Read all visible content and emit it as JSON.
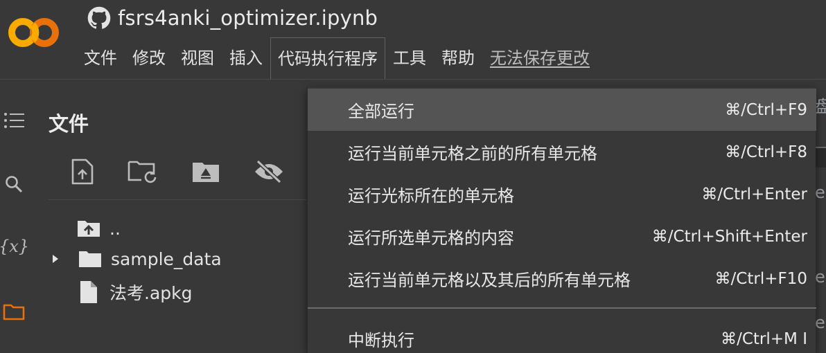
{
  "header": {
    "notebook_title": "fsrs4anki_optimizer.ipynb",
    "logo_colors": {
      "left_ring": "#f9ab00",
      "right_ring": "#e8710a"
    }
  },
  "menubar": {
    "items": [
      {
        "label": "文件"
      },
      {
        "label": "修改"
      },
      {
        "label": "视图"
      },
      {
        "label": "插入"
      },
      {
        "label": "代码执行程序",
        "active": true
      },
      {
        "label": "工具"
      },
      {
        "label": "帮助"
      }
    ],
    "unsaved_notice": "无法保存更改"
  },
  "sidebar": {
    "rail_icons": [
      "toc-icon",
      "search-icon",
      "variables-icon",
      "folder-icon"
    ],
    "variables_glyph": "{x}"
  },
  "file_panel": {
    "title": "文件",
    "toolbar_icons": [
      "upload-file-icon",
      "refresh-folder-icon",
      "mount-drive-icon",
      "hide-files-icon"
    ],
    "tree": [
      {
        "label": "..",
        "icon": "folder-up-icon"
      },
      {
        "label": "sample_data",
        "icon": "folder-icon",
        "expandable": true
      },
      {
        "label": "法考.apkg",
        "icon": "file-icon"
      }
    ]
  },
  "dropdown": {
    "items": [
      {
        "label": "全部运行",
        "shortcut": "⌘/Ctrl+F9"
      },
      {
        "label": "运行当前单元格之前的所有单元格",
        "shortcut": "⌘/Ctrl+F8"
      },
      {
        "label": "运行光标所在的单元格",
        "shortcut": "⌘/Ctrl+Enter"
      },
      {
        "label": "运行所选单元格的内容",
        "shortcut": "⌘/Ctrl+Shift+Enter"
      },
      {
        "label": "运行当前单元格以及其后的所有单元格",
        "shortcut": "⌘/Ctrl+F10"
      },
      {
        "label": "中断执行",
        "shortcut": "⌘/Ctrl+M I"
      }
    ]
  },
  "colors": {
    "background": "#383838",
    "hover": "#545454",
    "accent_folder": "#e8710a",
    "text": "#e3e3e3"
  }
}
